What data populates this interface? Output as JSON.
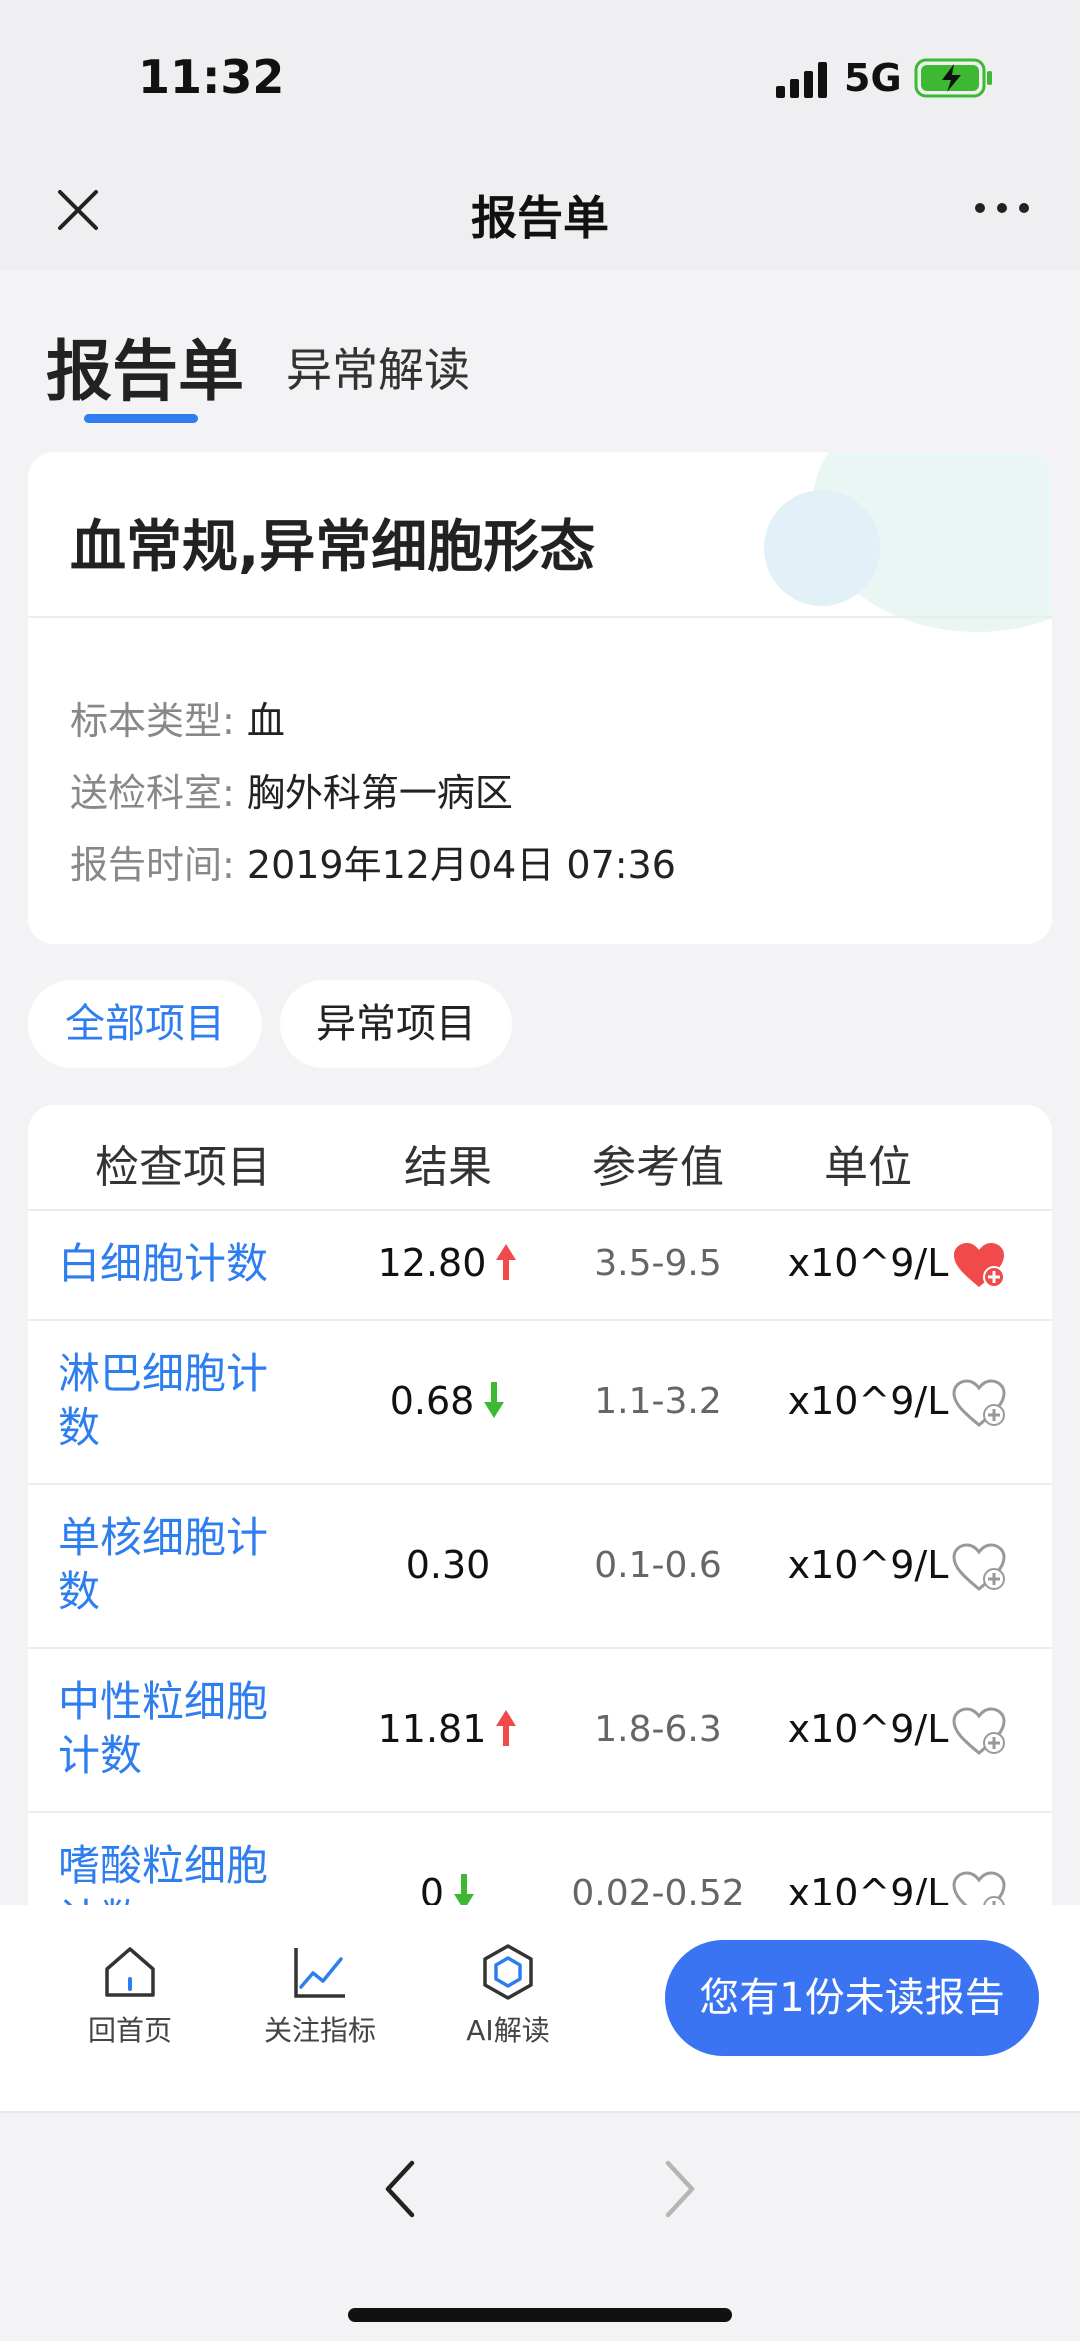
{
  "status_bar": {
    "time": "11:32",
    "network": "5G",
    "battery_charging": true
  },
  "nav": {
    "title": "报告单"
  },
  "tabs": {
    "main": "报告单",
    "secondary": "异常解读"
  },
  "report": {
    "title": "血常规,异常细胞形态",
    "specimen_label": "标本类型:",
    "specimen_value": "血",
    "dept_label": "送检科室:",
    "dept_value": "胸外科第一病区",
    "time_label": "报告时间:",
    "time_value": "2019年12月04日 07:36"
  },
  "filters": {
    "all": "全部项目",
    "abnormal": "异常项目",
    "selected": "all"
  },
  "table": {
    "headers": [
      "检查项目",
      "结果",
      "参考值",
      "单位"
    ],
    "rows": [
      {
        "name": "白细胞计数",
        "result": "12.80",
        "flag": "up",
        "ref": "3.5-9.5",
        "unit": "x10^9/L",
        "followed": true
      },
      {
        "name": "淋巴细胞计数",
        "result": "0.68",
        "flag": "down",
        "ref": "1.1-3.2",
        "unit": "x10^9/L",
        "followed": false
      },
      {
        "name": "单核细胞计数",
        "result": "0.30",
        "flag": "none",
        "ref": "0.1-0.6",
        "unit": "x10^9/L",
        "followed": false
      },
      {
        "name": "中性粒细胞计数",
        "result": "11.81",
        "flag": "up",
        "ref": "1.8-6.3",
        "unit": "x10^9/L",
        "followed": false
      },
      {
        "name": "嗜酸粒细胞计数",
        "result": "0",
        "flag": "down",
        "ref": "0.02-0.52",
        "unit": "x10^9/L",
        "followed": false
      }
    ]
  },
  "bottom_bar": {
    "home": "回首页",
    "follow": "关注指标",
    "ai": "AI解读",
    "unread_button": "您有1份未读报告"
  },
  "colors": {
    "accent": "#2f7ef0",
    "up": "#f04a4a",
    "down": "#3cb833",
    "button": "#3a74f3"
  }
}
